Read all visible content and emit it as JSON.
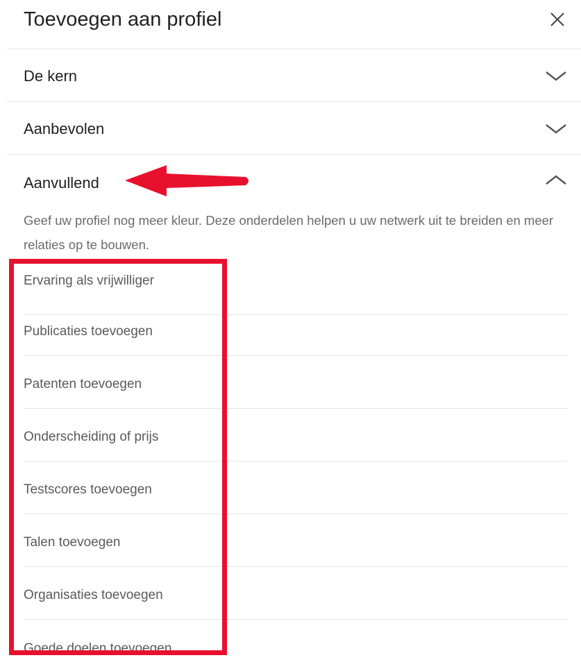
{
  "dialog": {
    "title": "Toevoegen aan profiel",
    "close_icon": "close-icon"
  },
  "sections": [
    {
      "label": "De kern",
      "state": "collapsed",
      "icon": "chevron-down-icon"
    },
    {
      "label": "Aanbevolen",
      "state": "collapsed",
      "icon": "chevron-down-icon"
    },
    {
      "label": "Aanvullend",
      "state": "expanded",
      "icon": "chevron-up-icon"
    }
  ],
  "aanvullend": {
    "description": "Geef uw profiel nog meer kleur. Deze onderdelen helpen u uw netwerk uit te breiden en meer relaties op te bouwen.",
    "items": [
      "Ervaring als vrijwilliger",
      "Publicaties toevoegen",
      "Patenten toevoegen",
      "Onderscheiding of prijs",
      "Testscores toevoegen",
      "Talen toevoegen",
      "Organisaties toevoegen",
      "Goede doelen toevoegen"
    ]
  },
  "annotations": {
    "color": "#e8112d",
    "arrow_icon": "arrow-left-icon"
  }
}
